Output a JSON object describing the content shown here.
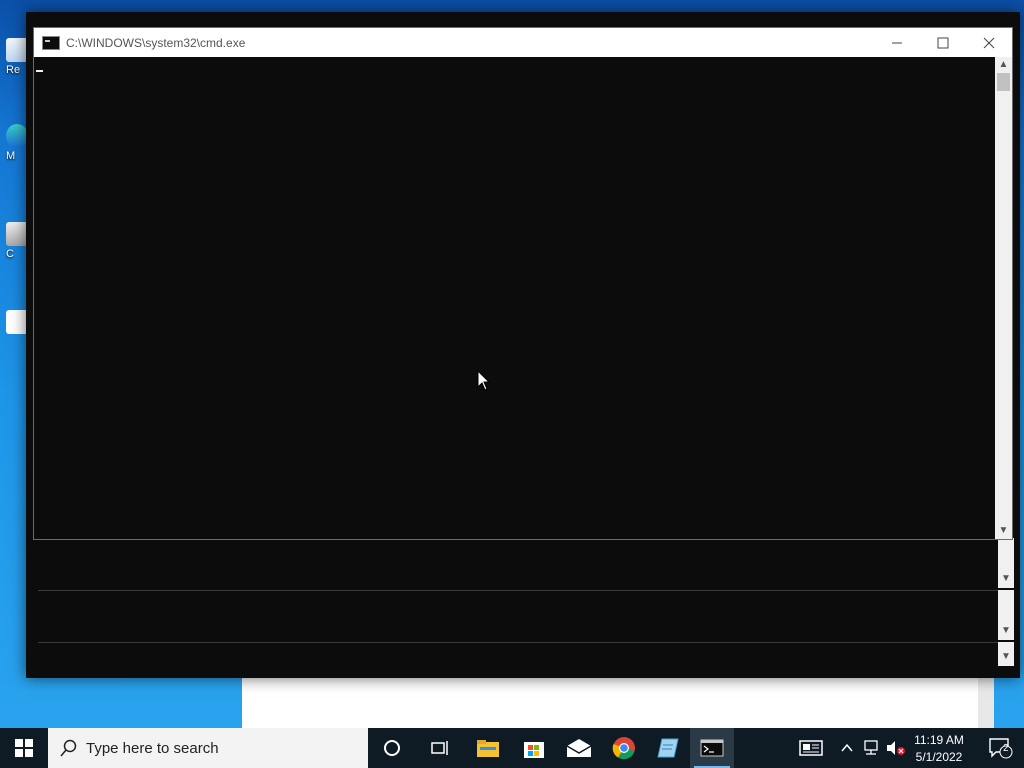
{
  "window": {
    "title": "C:\\WINDOWS\\system32\\cmd.exe",
    "minimize_label": "—",
    "maximize_label": "☐",
    "close_label": "✕"
  },
  "desktop": {
    "icons": [
      {
        "label": "Re"
      },
      {
        "label": "M"
      },
      {
        "label": "C"
      }
    ]
  },
  "taskbar": {
    "search_placeholder": "Type here to search",
    "time": "11:19 AM",
    "date": "5/1/2022",
    "notification_count": "2",
    "pinned": [
      {
        "name": "cortana-icon"
      },
      {
        "name": "task-view-icon"
      },
      {
        "name": "file-explorer-icon"
      },
      {
        "name": "microsoft-store-icon"
      },
      {
        "name": "mail-icon"
      },
      {
        "name": "chrome-icon"
      },
      {
        "name": "notepad-icon"
      },
      {
        "name": "command-prompt-icon"
      }
    ]
  }
}
